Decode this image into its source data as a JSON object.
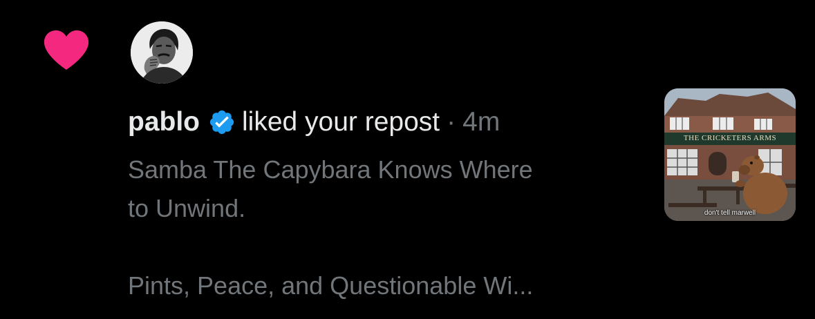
{
  "notification": {
    "type_icon": "heart-icon",
    "type_icon_color": "#f4287f",
    "avatar_icon": "avatar-portrait",
    "user_name": "pablo",
    "verified_icon": "verified-badge-icon",
    "verified_color": "#1d9bf0",
    "action_text": "liked your repost",
    "separator": "·",
    "timestamp": "4m",
    "post_lines": [
      "Samba The Capybara Knows Where",
      "to Unwind.",
      "Pints, Peace, and Questionable Wi..."
    ],
    "thumbnail": {
      "sign_text": "THE CRICKETERS ARMS",
      "caption": "don't tell marwell"
    }
  },
  "colors": {
    "background": "#000000",
    "primary_text": "#e7e9ea",
    "secondary_text": "#71767b"
  }
}
